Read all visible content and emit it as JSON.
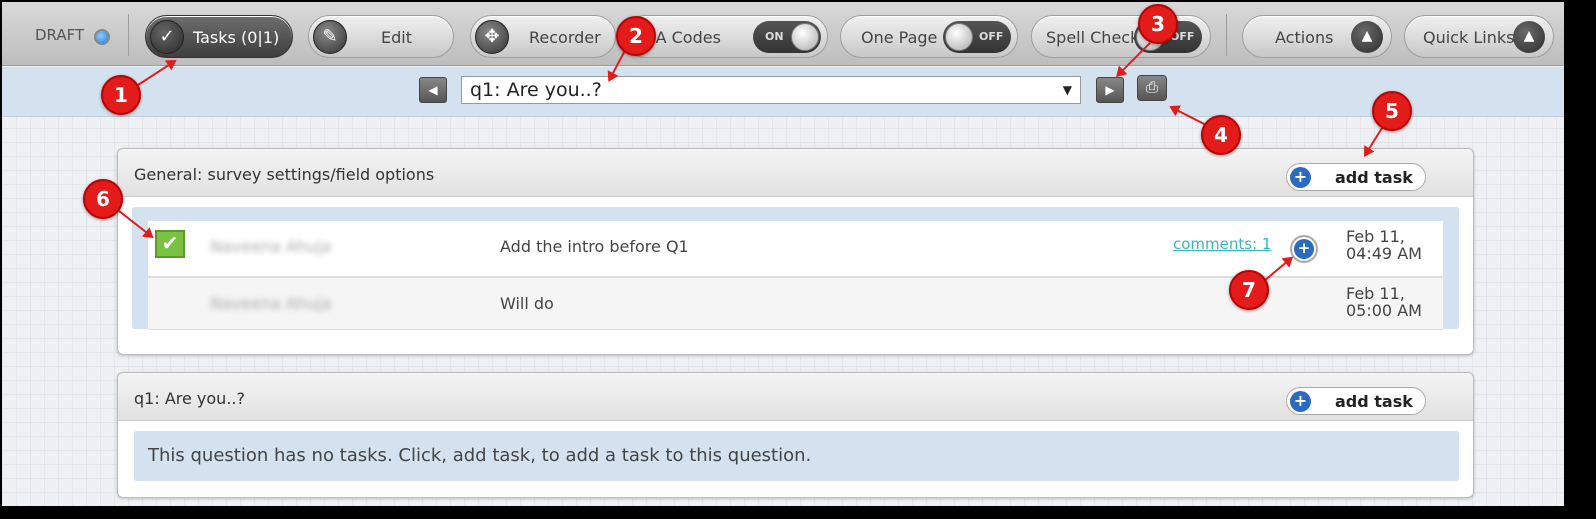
{
  "toolbar": {
    "draft_label": "DRAFT",
    "tasks_label": "Tasks (0|1)",
    "edit_label": "Edit",
    "recorder_label": "Recorder",
    "qa_codes_label": "QA Codes",
    "qa_codes_state": "ON",
    "one_page_label": "One Page",
    "one_page_state": "OFF",
    "spell_check_label": "Spell Check",
    "spell_check_state": "OFF",
    "actions_label": "Actions",
    "quick_links_label": "Quick Links"
  },
  "nav": {
    "question_selected": "q1: Are you..?"
  },
  "sections": [
    {
      "title": "General: survey settings/field options",
      "add_task_label": "add task",
      "tasks": [
        {
          "author": "Naveena Ahuja",
          "message": "Add the intro before Q1",
          "comments": "comments: 1",
          "date_line1": "Feb 11,",
          "date_line2": "04:49 AM"
        },
        {
          "author": "Naveena Ahuja",
          "message": "Will do",
          "date_line1": "Feb 11,",
          "date_line2": "05:00 AM"
        }
      ]
    },
    {
      "title": "q1: Are you..?",
      "add_task_label": "add task",
      "empty_message": "This question has no tasks. Click, add task, to add a task to this question."
    }
  ],
  "callouts": [
    "1",
    "2",
    "3",
    "4",
    "5",
    "6",
    "7"
  ],
  "colors": {
    "callout": "#e31b1b",
    "accent_blue": "#2a6bc2",
    "link": "#36b5c4",
    "nav_bg": "#d4e2ef"
  }
}
